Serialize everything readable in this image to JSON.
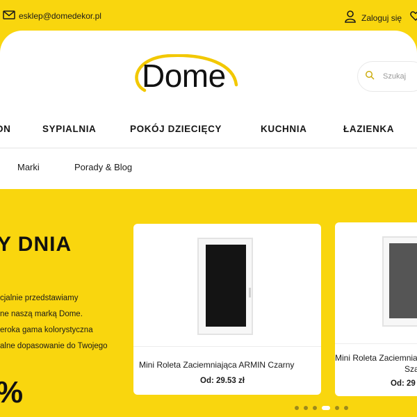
{
  "topbar": {
    "email": "esklep@domedekor.pl",
    "login_label": "Zaloguj się",
    "icons": [
      "mail-icon",
      "user-icon",
      "heart-icon"
    ]
  },
  "header": {
    "logo_text": "Dome",
    "search_placeholder": "Szukaj",
    "search_icon": "search-icon"
  },
  "nav": {
    "items": [
      {
        "label": "ON"
      },
      {
        "label": "SYPIALNIA"
      },
      {
        "label": "POKÓJ DZIECIĘCY"
      },
      {
        "label": "KUCHNIA"
      },
      {
        "label": "ŁAZIENKA"
      }
    ]
  },
  "subnav": {
    "items": [
      {
        "label": "Marki"
      },
      {
        "label": "Porady & Blog"
      }
    ]
  },
  "hero": {
    "title": "Y DNIA",
    "desc_lines": [
      "cjalnie przedstawiamy",
      "ne naszą marką Dome.",
      "eroka gama kolorystyczna",
      "alne dopasowanie do Twojego"
    ],
    "big_text": "%"
  },
  "products": [
    {
      "name": "Mini Roleta Zaciemniająca ARMIN Czarny",
      "price": "Od: 29.53 zł"
    },
    {
      "name": "Mini Roleta Zaciemnia",
      "name2": "Sza",
      "price": "Od: 29"
    }
  ],
  "carousel": {
    "dot_count": 6,
    "active_index": 3
  },
  "colors": {
    "brand_yellow": "#f9d60e",
    "white": "#ffffff",
    "text": "#1a1a1a"
  }
}
